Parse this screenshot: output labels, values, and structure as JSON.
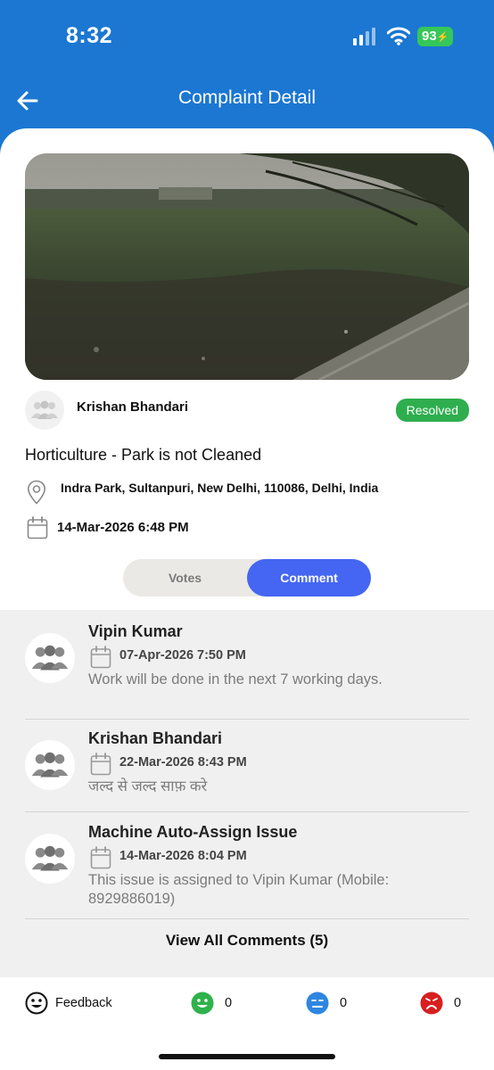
{
  "status_bar": {
    "time": "8:32",
    "battery": "93"
  },
  "header": {
    "title": "Complaint Detail"
  },
  "complaint": {
    "reporter_name": "Krishan Bhandari",
    "status": "Resolved",
    "title": "Horticulture - Park is not Cleaned",
    "address": "Indra Park, Sultanpuri, New Delhi, 110086, Delhi, India",
    "date": "14-Mar-2026 6:48 PM"
  },
  "tabs": {
    "votes": "Votes",
    "comment": "Comment",
    "active": "Comment"
  },
  "comments": [
    {
      "name": "Vipin Kumar",
      "date": "07-Apr-2026 7:50 PM",
      "text": "Work will be done in the next 7 working days."
    },
    {
      "name": "Krishan Bhandari",
      "date": "22-Mar-2026 8:43 PM",
      "text": "जल्द से जल्द साफ़ करे"
    },
    {
      "name": "Machine Auto-Assign Issue",
      "date": "14-Mar-2026 8:04 PM",
      "text": "This issue is assigned to Vipin Kumar (Mobile: 8929886019)"
    }
  ],
  "view_all_label": "View All Comments (5)",
  "feedback": {
    "label": "Feedback",
    "happy_count": "0",
    "neutral_count": "0",
    "sad_count": "0"
  },
  "colors": {
    "brand_blue": "#1b77d2",
    "resolved_green": "#2eae4e",
    "active_tab": "#4566f2",
    "happy": "#2fb24c",
    "neutral": "#2f86e0",
    "sad": "#d81f1f"
  },
  "icons": [
    "signal-icon",
    "wifi-icon",
    "back-arrow-icon",
    "group-avatar-icon",
    "location-pin-icon",
    "calendar-icon",
    "smiley-icon",
    "happy-face-icon",
    "neutral-face-icon",
    "sad-face-icon"
  ]
}
